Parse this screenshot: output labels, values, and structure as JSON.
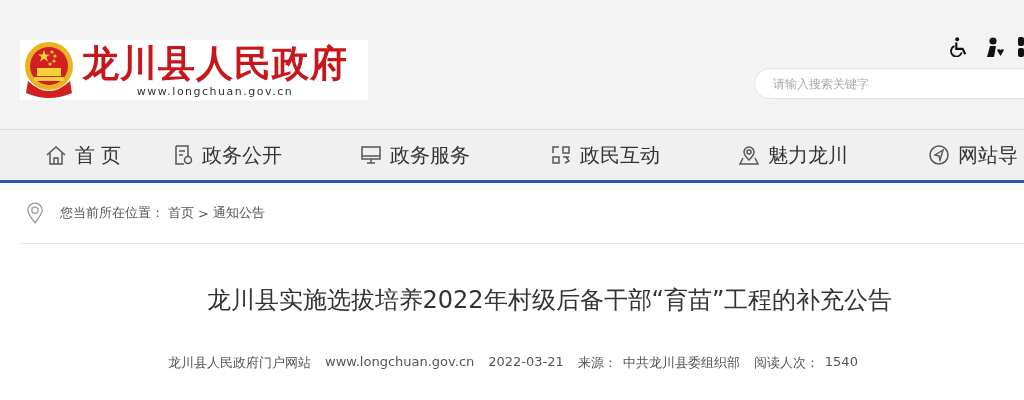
{
  "header": {
    "site_name": "龙川县人民政府",
    "site_url": "www.longchuan.gov.cn",
    "search": {
      "placeholder": "请输入搜索关键字"
    }
  },
  "nav": [
    {
      "label": "首 页"
    },
    {
      "label": "政务公开"
    },
    {
      "label": "政务服务"
    },
    {
      "label": "政民互动"
    },
    {
      "label": "魅力龙川"
    },
    {
      "label": "网站导"
    }
  ],
  "breadcrumb": {
    "prefix": "您当前所在位置：",
    "items": [
      "首页",
      "通知公告"
    ],
    "separator": ">"
  },
  "article": {
    "title": "龙川县实施选拔培养2022年村级后备干部“育苗”工程的补充公告",
    "meta": [
      "龙川县人民政府门户网站",
      "www.longchuan.gov.cn",
      "2022-03-21",
      "来源：",
      "中共龙川县委组织部",
      "阅读人次：",
      "1540"
    ]
  }
}
